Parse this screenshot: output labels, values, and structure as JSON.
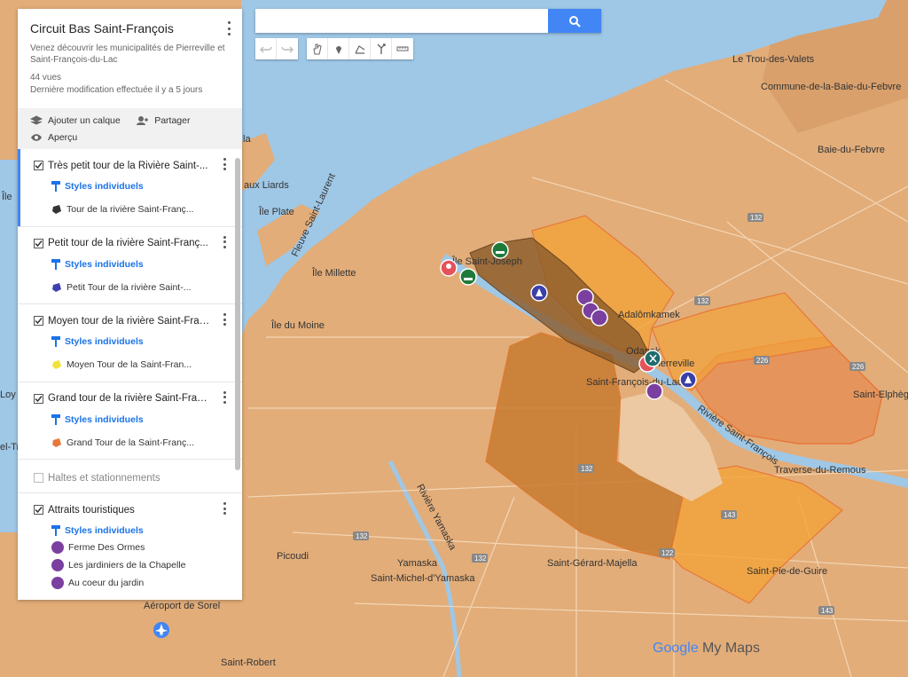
{
  "map": {
    "title": "Circuit Bas Saint-François",
    "description": "Venez découvrir les municipalités de Pierreville et Saint-François-du-Lac",
    "views": "44 vues",
    "modified": "Dernière modification effectuée il y a 5 jours"
  },
  "actions": {
    "add_layer": "Ajouter un calque",
    "share": "Partager",
    "preview": "Aperçu"
  },
  "layers": [
    {
      "title": "Très petit tour de la Rivière Saint-...",
      "style": "Styles individuels",
      "feature": "Tour de la rivière Saint-Franç...",
      "color": "#333333"
    },
    {
      "title": "Petit tour de la rivière Saint-Franç...",
      "style": "Styles individuels",
      "feature": "Petit Tour de la rivière Saint-...",
      "color": "#3f3fb0"
    },
    {
      "title": "Moyen tour de la rivière Saint-Fran...",
      "style": "Styles individuels",
      "feature": "Moyen Tour de la Saint-Fran...",
      "color": "#f2e33a"
    },
    {
      "title": "Grand tour de la rivière Saint-Fran...",
      "style": "Styles individuels",
      "feature": "Grand Tour de la Saint-Franç...",
      "color": "#e8783a"
    }
  ],
  "layer_off": {
    "title": "Haltes et stationnements"
  },
  "attractions": {
    "title": "Attraits touristiques",
    "style": "Styles individuels",
    "items": [
      "Ferme Des Ormes",
      "Les jardiniers de la Chapelle",
      "Au coeur du jardin"
    ]
  },
  "search": {
    "placeholder": ""
  },
  "place_labels": {
    "trou_des_valets": "Le Trou-des-Valets",
    "baie_du_febvre_commune": "Commune-de-la-Baie-du-Febvre",
    "baie_du_febvre": "Baie-du-Febvre",
    "aux_liards": "aux Liards",
    "ile_plate": "Île Plate",
    "fleuve": "Fleuve Saint-Laurent",
    "ile_millette": "Île Millette",
    "ile_du_moine": "Île du Moine",
    "ile_st_joseph": "Île Saint-Joseph",
    "adalomkamek": "Adalômkamek",
    "odanak": "Odanak",
    "pierreville": "Pierreville",
    "st_francois": "Saint-François-du-Lac",
    "st_elphege": "Saint-Elphège",
    "riviere_st_francois": "Rivière Saint-François",
    "traverse": "Traverse-du-Remous",
    "riviere_yamaska": "Rivière Yamaska",
    "picoudi": "Picoudi",
    "yamaska": "Yamaska",
    "st_michel": "Saint-Michel-d'Yamaska",
    "st_gerard": "Saint-Gérard-Majella",
    "st_pie": "Saint-Pie-de-Guire",
    "aeroport": "Aéroport de Sorel",
    "st_robert": "Saint-Robert",
    "la": "la",
    "ile": "Île",
    "loy": "Loy",
    "el_trei": "el-Trei"
  },
  "road_numbers": {
    "r132": "132",
    "r143": "143",
    "r226": "226",
    "r122": "122"
  },
  "brand": {
    "google": "Google",
    "mymaps": "My Maps"
  }
}
